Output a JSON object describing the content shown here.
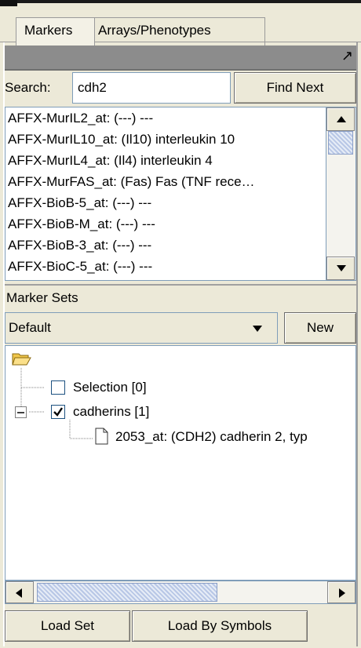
{
  "tabs": [
    {
      "label": "Markers",
      "active": true
    },
    {
      "label": "Arrays/Phenotypes",
      "active": false
    }
  ],
  "search": {
    "label": "Search:",
    "value": "cdh2",
    "find_next": "Find Next"
  },
  "markers": [
    "AFFX-MurIL2_at: (---) ---",
    "AFFX-MurIL10_at: (Il10) interleukin 10",
    "AFFX-MurIL4_at: (Il4) interleukin 4",
    "AFFX-MurFAS_at: (Fas) Fas (TNF rece…",
    "AFFX-BioB-5_at: (---) ---",
    "AFFX-BioB-M_at: (---) ---",
    "AFFX-BioB-3_at: (---) ---",
    "AFFX-BioC-5_at: (---) ---"
  ],
  "marker_sets": {
    "label": "Marker Sets",
    "selected": "Default",
    "new_label": "New",
    "tree": {
      "selection": "Selection [0]",
      "cadherins": "cadherins [1]",
      "cadherin_item": "2053_at: (CDH2) cadherin 2, typ"
    }
  },
  "buttons": {
    "load_set": "Load Set",
    "load_by_symbols": "Load By Symbols"
  },
  "icons": {
    "maximize": "maximize-icon",
    "folder": "open-folder-icon",
    "doc": "document-icon"
  }
}
